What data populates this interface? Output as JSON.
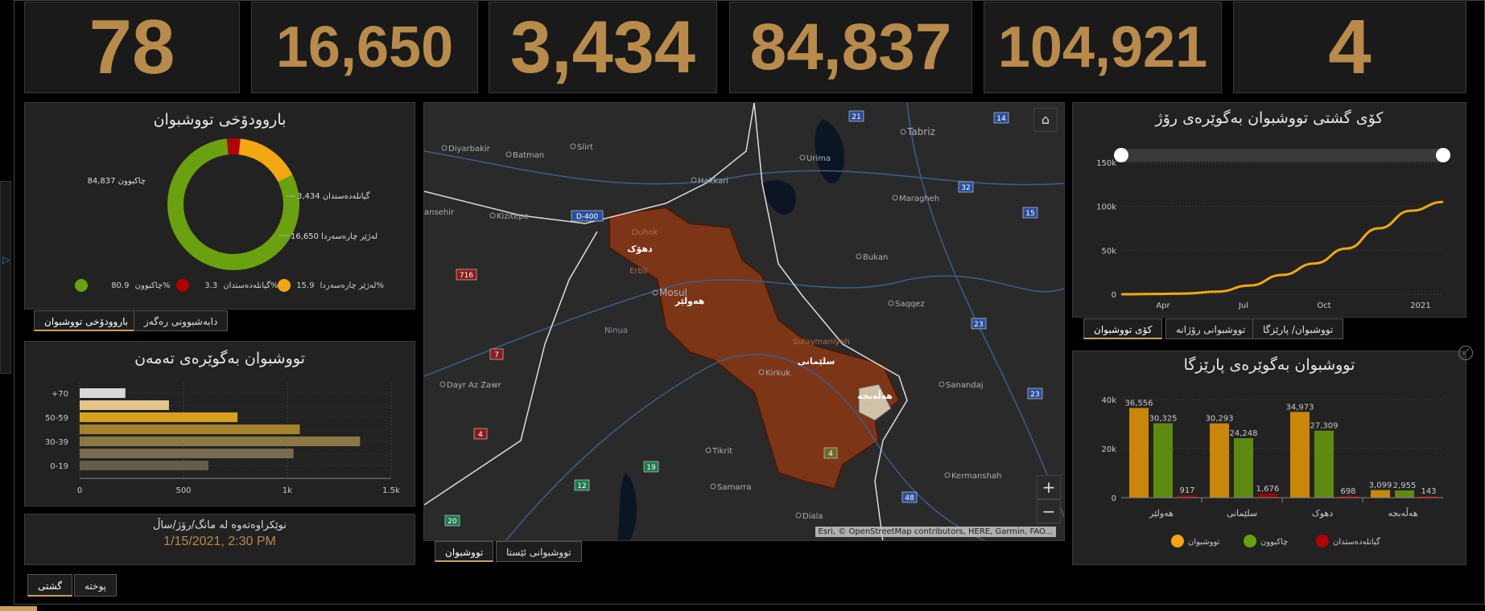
{
  "kpis": [
    "78",
    "16,650",
    "3,434",
    "84,837",
    "104,921",
    "4"
  ],
  "donut": {
    "title": "باروودۆخی تووشبوان",
    "labels": {
      "recovered": "84,837 چاکبوون",
      "deaths": "3,434 گیانلەدەستدان",
      "active": "16,650 لەژێر چارەسەردا"
    },
    "legend": [
      {
        "name": "چاکبوون",
        "pct": "80.9%",
        "color": "#6aa10f"
      },
      {
        "name": "گیانلەدەستدان",
        "pct": "3.3%",
        "color": "#b30000"
      },
      {
        "name": "لەژێر چارەسەردا",
        "pct": "15.9%",
        "color": "#f3a710"
      }
    ],
    "fractions": [
      0.809,
      0.033,
      0.159
    ]
  },
  "tabs_left": {
    "status": "باروودۆخی تووشبوان",
    "gender": "دابەشبوونی رەگەز"
  },
  "age": {
    "title": "تووشبوان بەگوێرەی تەمەن",
    "categories": [
      "+70",
      "",
      "50-59",
      "",
      "30-39",
      "",
      "0-19"
    ],
    "values": [
      220,
      430,
      760,
      1060,
      1350,
      1030,
      620
    ],
    "colors": [
      "#d8d8d8",
      "#e3c48a",
      "#d6a21e",
      "#a5822c",
      "#8b7845",
      "#776b50",
      "#655c4c"
    ],
    "xticks": [
      "0",
      "500",
      "1k",
      "1.5k"
    ],
    "xmax": 1500
  },
  "updated": {
    "label": "نوێکراوەتەوە لە مانگ/رۆژ/ساڵ",
    "value": "1/15/2021, 2:30 PM"
  },
  "bottom_tabs": {
    "general": "گشتی",
    "week": "پوختە"
  },
  "map": {
    "places": [
      {
        "name": "Tabriz"
      },
      {
        "name": "Diyarbakir"
      },
      {
        "name": "Batman"
      },
      {
        "name": "Siirt"
      },
      {
        "name": "Hakkari"
      },
      {
        "name": "Urima"
      },
      {
        "name": "Maragheh"
      },
      {
        "name": "Bukan"
      },
      {
        "name": "Saqqez"
      },
      {
        "name": "Mosul"
      },
      {
        "name": "Ninua"
      },
      {
        "name": "Kizitepe"
      },
      {
        "name": "ansehir"
      },
      {
        "name": "Dayr Az Zawr"
      },
      {
        "name": "Kirkuk"
      },
      {
        "name": "Tikrit"
      },
      {
        "name": "Samarra"
      },
      {
        "name": "Sanandaj"
      },
      {
        "name": "Kermanshah"
      },
      {
        "name": "Diala"
      },
      {
        "name": "Duhok"
      },
      {
        "name": "Erbil"
      },
      {
        "name": "Sulaymaniyah"
      }
    ],
    "regions": [
      "دهۆک",
      "هەولێر",
      "سلێمانی",
      "هەڵەبجە"
    ],
    "shields": [
      "21",
      "14",
      "32",
      "15",
      "23",
      "23",
      "48",
      "D-400",
      "716",
      "7",
      "4",
      "19",
      "12",
      "20",
      "4"
    ],
    "attribution": "Esri, © OpenStreetMap contributors, HERE, Garmin, FAO...",
    "zoom_in": "+",
    "zoom_out": "−",
    "tabs": {
      "cases": "تووشبوان",
      "now": "تووشبوانی ئێستا"
    }
  },
  "line": {
    "title": "کۆی گشتی تووشبوان بەگوێرەی رۆژ",
    "yticks": [
      "150k",
      "100k",
      "50k",
      "0"
    ],
    "xticks": [
      "Apr",
      "Jul",
      "Oct",
      "2021"
    ]
  },
  "tabs_right": {
    "total": "کۆی تووشبوان",
    "daily": "تووشبوانی رۆژانە",
    "province": "تووشبوان/ پارێزگا"
  },
  "prov": {
    "title": "تووشبوان بەگوێرەی پارێزگا",
    "categories": [
      "هەولێر",
      "سلێمانی",
      "دهوک",
      "هەڵەبجە"
    ],
    "yticks": [
      "40k",
      "20k",
      "0"
    ],
    "ymax": 40000,
    "series": [
      {
        "name": "تووشبوان",
        "color": "#c8870a",
        "values": [
          36556,
          30293,
          34973,
          3099
        ],
        "labels": [
          "36,556",
          "30,293",
          "34,973",
          "3,099"
        ]
      },
      {
        "name": "چاکبوون",
        "color": "#5f8a12",
        "values": [
          30325,
          24248,
          27309,
          2955
        ],
        "labels": [
          "30,325",
          "24,248",
          "27,309",
          "2,955"
        ]
      },
      {
        "name": "گیانلەدەستدان",
        "color": "#9e0000",
        "values": [
          917,
          1676,
          698,
          143
        ],
        "labels": [
          "917",
          "1,676",
          "698",
          "143"
        ]
      }
    ]
  },
  "chart_data": [
    {
      "type": "line",
      "title": "کۆی گشتی تووشبوان بەگوێرەی رۆژ",
      "x": [
        "2020-03",
        "2020-04",
        "2020-05",
        "2020-06",
        "2020-07",
        "2020-08",
        "2020-09",
        "2020-10",
        "2020-11",
        "2020-12",
        "2021-01"
      ],
      "series": [
        {
          "values": [
            0,
            300,
            800,
            3000,
            10000,
            22000,
            35000,
            52000,
            75000,
            95000,
            104921
          ]
        }
      ],
      "ylim": [
        0,
        150000
      ],
      "xticks": [
        "Apr",
        "Jul",
        "Oct",
        "2021"
      ]
    },
    {
      "type": "bar",
      "title": "تووشبوان بەگوێرەی پارێزگا",
      "categories": [
        "هەولێر",
        "سلێمانی",
        "دهوک",
        "هەڵەبجە"
      ],
      "series": [
        {
          "name": "تووشبوان",
          "values": [
            36556,
            30293,
            34973,
            3099
          ]
        },
        {
          "name": "چاکبوون",
          "values": [
            30325,
            24248,
            27309,
            2955
          ]
        },
        {
          "name": "گیانلەدەستدان",
          "values": [
            917,
            1676,
            698,
            143
          ]
        }
      ],
      "ylim": [
        0,
        40000
      ]
    },
    {
      "type": "bar",
      "title": "تووشبوان بەگوێرەی تەمەن",
      "categories": [
        "+70",
        "",
        "50-59",
        "",
        "30-39",
        "",
        "0-19"
      ],
      "values": [
        220,
        430,
        760,
        1060,
        1350,
        1030,
        620
      ],
      "xlim": [
        0,
        1500
      ]
    },
    {
      "type": "pie",
      "title": "باروودۆخی تووشبوان",
      "categories": [
        "چاکبوون",
        "گیانلەدەستدان",
        "لەژێر چارەسەردا"
      ],
      "values": [
        84837,
        3434,
        16650
      ]
    }
  ]
}
